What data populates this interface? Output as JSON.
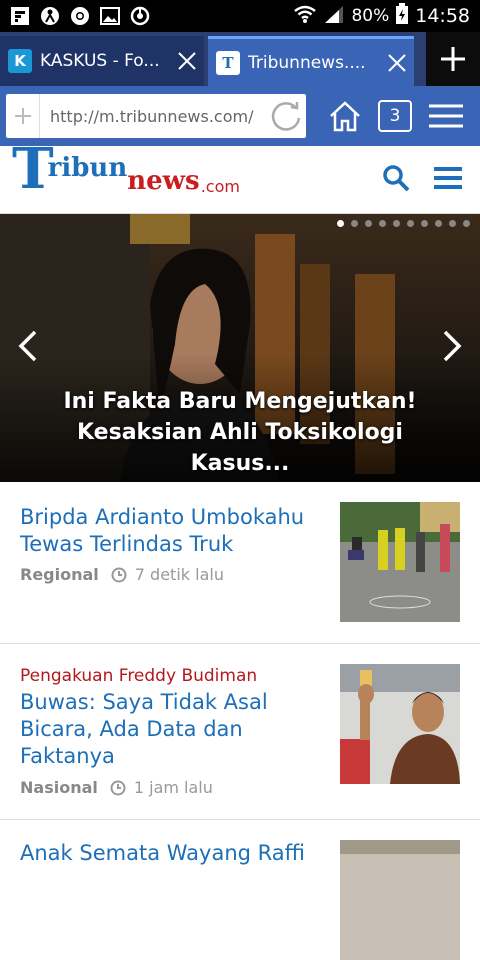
{
  "status_bar": {
    "battery": "80%",
    "time": "14:58",
    "left_icons": [
      "flipboard-icon",
      "person-icon",
      "chrome-icon",
      "image-icon",
      "headset-icon"
    ]
  },
  "tabs": [
    {
      "title": "KASKUS - Fo...",
      "favicon": "K",
      "active": false
    },
    {
      "title": "Tribunnews....",
      "favicon": "T",
      "active": true
    }
  ],
  "address_bar": {
    "url": "http://m.tribunnews.com/",
    "tab_count": "3"
  },
  "site": {
    "logo_main": "Tribun",
    "logo_news": "news",
    "logo_suffix": ".com"
  },
  "hero": {
    "caption": "Ini Fakta Baru Mengejutkan! Kesaksian Ahli Toksikologi Kasus...",
    "dots_total": 10,
    "active_dot": 0
  },
  "articles": [
    {
      "kicker": "",
      "title": "Bripda Ardianto Umbokahu Tewas Terlindas Truk",
      "category": "Regional",
      "time": "7 detik lalu"
    },
    {
      "kicker": "Pengakuan Freddy Budiman",
      "title": "Buwas: Saya Tidak Asal Bicara, Ada Data dan Faktanya",
      "category": "Nasional",
      "time": "1 jam lalu"
    },
    {
      "kicker": "",
      "title": "Anak Semata Wayang Raffi",
      "category": "",
      "time": ""
    }
  ],
  "colors": {
    "tab_bar": "#2b3f73",
    "url_bar": "#3a64b6",
    "brand_blue": "#1c6fb8",
    "brand_red": "#c81e1e"
  }
}
